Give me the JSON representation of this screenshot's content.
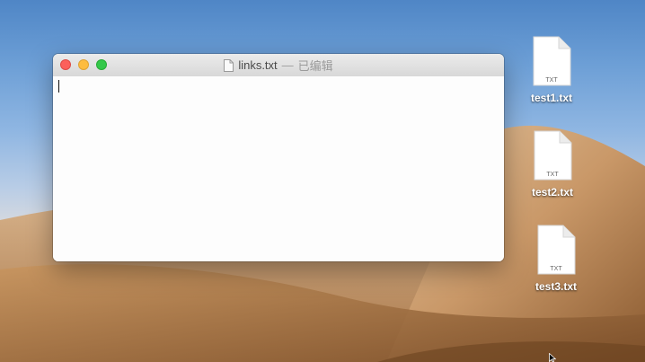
{
  "window": {
    "file_name": "links.txt",
    "separator": "—",
    "status": "已编辑",
    "content": ""
  },
  "desktop": {
    "files": [
      {
        "name": "test1.txt",
        "badge": "TXT"
      },
      {
        "name": "test2.txt",
        "badge": "TXT"
      },
      {
        "name": "test3.txt",
        "badge": "TXT"
      }
    ]
  },
  "icons": {
    "title_document": "document-icon",
    "desktop_file": "txt-file-icon",
    "pointer": "mouse-pointer-icon"
  },
  "colors": {
    "close": "#fc605b",
    "minimize": "#fdbc40",
    "maximize": "#34c84a",
    "sky": "#6d9fd6",
    "sand": "#c89a66"
  }
}
